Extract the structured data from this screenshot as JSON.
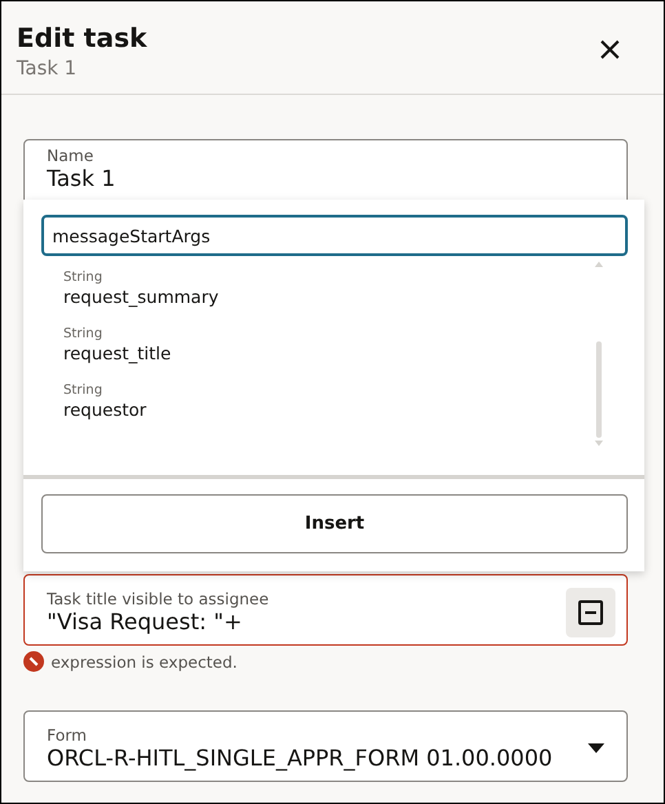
{
  "dialog": {
    "title": "Edit task",
    "subtitle": "Task 1"
  },
  "name_field": {
    "label": "Name",
    "value": "Task 1"
  },
  "picker": {
    "search": {
      "value": "messageStartArgs"
    },
    "items": [
      {
        "type": "String",
        "name": "request_summary"
      },
      {
        "type": "String",
        "name": "request_title"
      },
      {
        "type": "String",
        "name": "requestor"
      }
    ],
    "insert_button": "Insert"
  },
  "title_field": {
    "label": "Task title visible to assignee",
    "value": "\"Visa Request: \"+",
    "invalid": true,
    "error": "expression is expected."
  },
  "form_field": {
    "label": "Form",
    "value": "ORCL-R-HITL_SINGLE_APPR_FORM 01.00.0000"
  }
}
